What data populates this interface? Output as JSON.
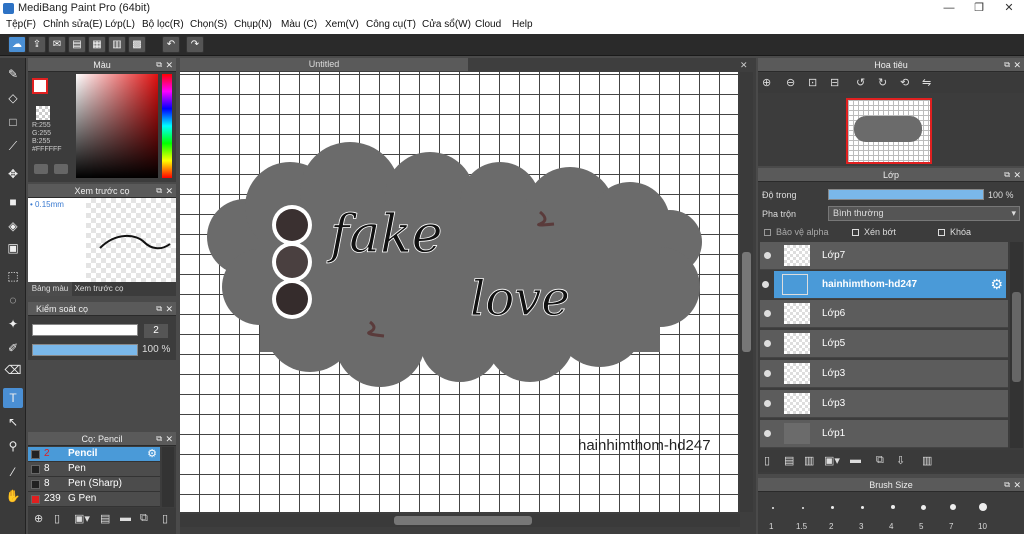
{
  "window": {
    "title": "MediBang Paint Pro (64bit)",
    "min": "—",
    "max": "❐",
    "close": "✕"
  },
  "menu": [
    "Tệp(F)",
    "Chỉnh sửa(E)",
    "Lớp(L)",
    "Bộ lọc(R)",
    "Chọn(S)",
    "Chụp(N)",
    "Màu (C)",
    "Xem(V)",
    "Công cụ(T)",
    "Cửa sổ(W)",
    "Cloud",
    "Help"
  ],
  "color_panel": {
    "title": "Màu",
    "r": "R:255",
    "g": "G:255",
    "b": "B:255",
    "hex": "#FFFFFF"
  },
  "brush_preview": {
    "title": "Xem trước cọ",
    "size": "0.15mm",
    "tab1": "Bảng màu",
    "tab2": "Xem trước cọ"
  },
  "brush_control": {
    "title": "Kiểm soát cọ",
    "size_value": "2",
    "opacity_value": "100 %",
    "opacity": 1.0
  },
  "brush_list": {
    "title": "Cọ: Pencil",
    "items": [
      {
        "size": "2",
        "name": "Pencil",
        "selected": true,
        "swatch": "#222222"
      },
      {
        "size": "8",
        "name": "Pen",
        "selected": false,
        "swatch": "#222222"
      },
      {
        "size": "8",
        "name": "Pen (Sharp)",
        "selected": false,
        "swatch": "#222222"
      },
      {
        "size": "239",
        "name": "G Pen",
        "selected": false,
        "swatch": "#e02020"
      }
    ]
  },
  "document": {
    "tab": "Untitled",
    "text_fake": "fake",
    "text_love": "love",
    "watermark": "hainhimthom-hd247"
  },
  "navigator": {
    "title": "Hoa tiêu"
  },
  "layer_panel": {
    "title": "Lớp",
    "opacity_label": "Độ trong",
    "opacity_value": "100 %",
    "opacity": 1.0,
    "blend_label": "Pha trộn",
    "blend_value": "Bình thường",
    "protect_alpha": "Bảo vệ alpha",
    "clipping": "Xén bớt",
    "lock": "Khóa",
    "layers": [
      {
        "name": "Lớp7",
        "selected": false
      },
      {
        "name": "hainhimthom-hd247",
        "selected": true
      },
      {
        "name": "Lớp6",
        "selected": false
      },
      {
        "name": "Lớp5",
        "selected": false
      },
      {
        "name": "Lớp3",
        "selected": false
      },
      {
        "name": "Lớp3",
        "selected": false
      },
      {
        "name": "Lớp1",
        "selected": false
      }
    ]
  },
  "brush_size": {
    "title": "Brush Size",
    "sizes": [
      "1",
      "1.5",
      "2",
      "3",
      "4",
      "5",
      "7",
      "10"
    ]
  },
  "colors": {
    "accent": "#4a9ad8",
    "cloud": "#6b6b6b"
  }
}
